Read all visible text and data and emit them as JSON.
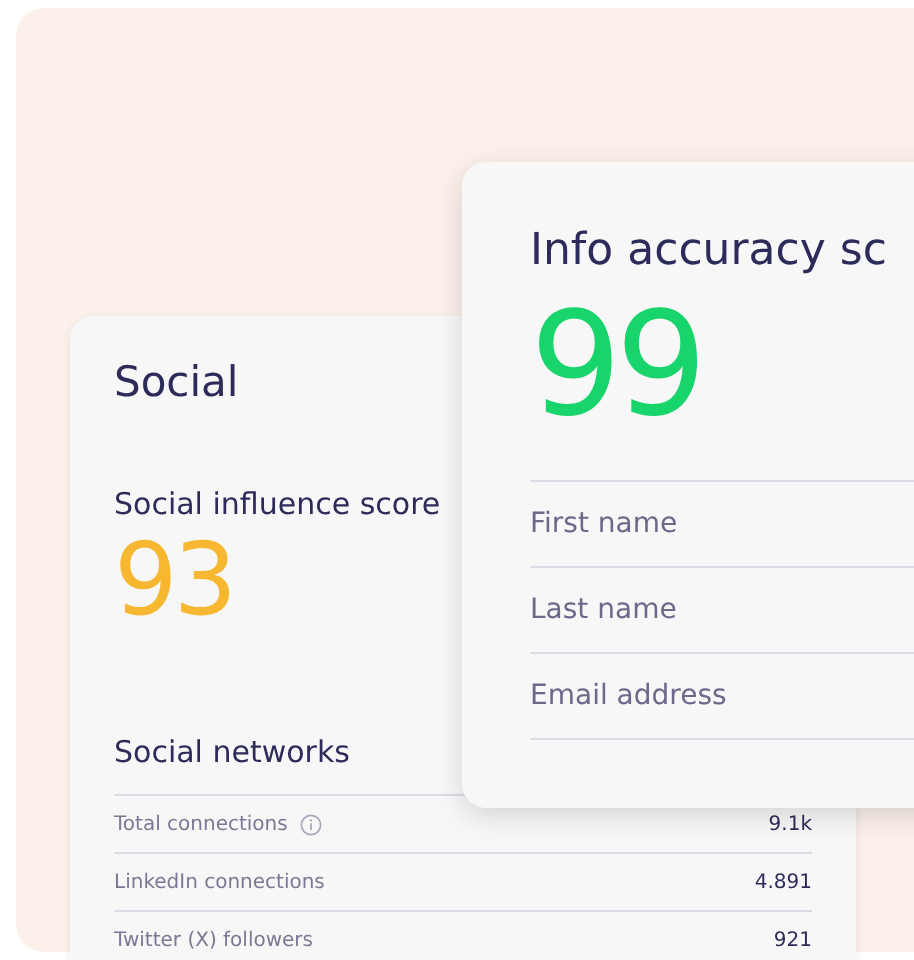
{
  "social_card": {
    "title": "Social",
    "score_label": "Social influence score",
    "score": "93",
    "networks_title": "Social networks",
    "rows": [
      {
        "label": "Total connections",
        "info": true,
        "value": "9.1k"
      },
      {
        "label": "LinkedIn connections",
        "info": false,
        "value": "4.891"
      },
      {
        "label": "Twitter (X) followers",
        "info": false,
        "value": "921"
      }
    ]
  },
  "info_card": {
    "title": "Info accuracy sc",
    "score": "99",
    "fields": [
      "First name",
      "Last name",
      "Email address"
    ]
  }
}
